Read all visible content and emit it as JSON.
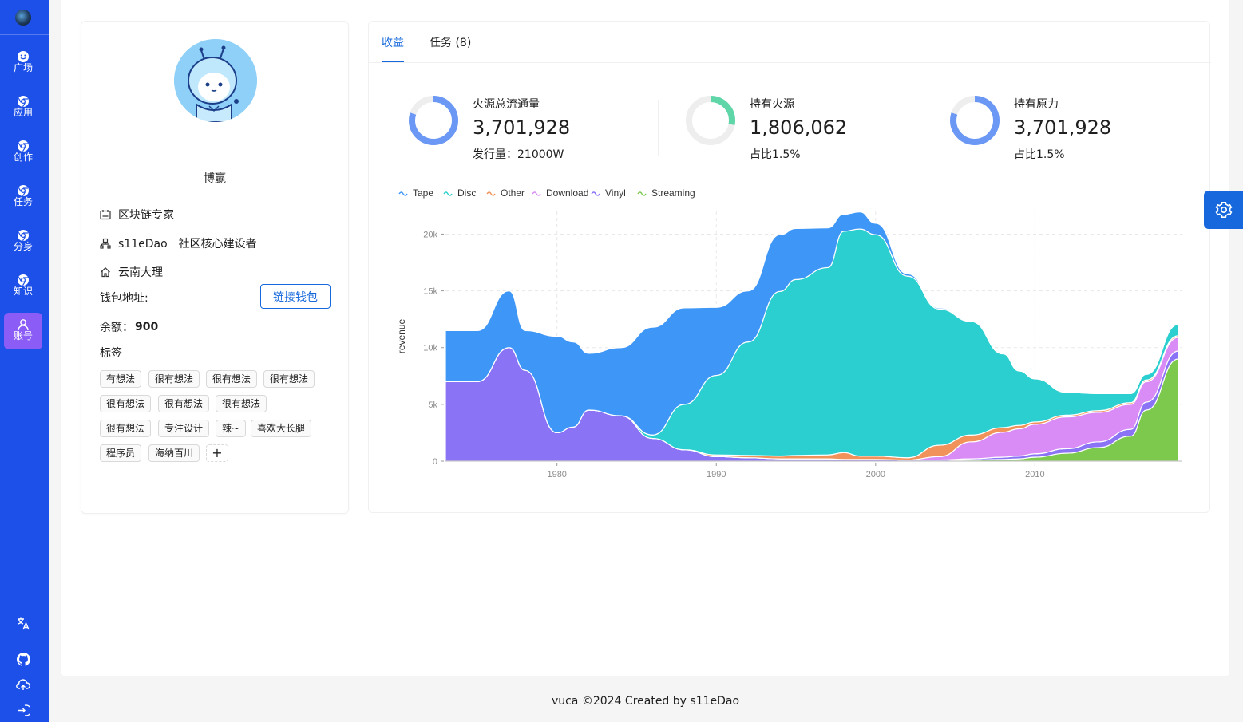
{
  "nav": {
    "items": [
      {
        "label": "广场",
        "icon": "smile-icon"
      },
      {
        "label": "应用",
        "icon": "chrome-icon"
      },
      {
        "label": "创作",
        "icon": "chrome-icon"
      },
      {
        "label": "任务",
        "icon": "chrome-icon"
      },
      {
        "label": "分身",
        "icon": "chrome-icon"
      },
      {
        "label": "知识",
        "icon": "chrome-icon"
      },
      {
        "label": "账号",
        "icon": "user-icon",
        "active": true
      }
    ],
    "bottom_icons": [
      "translate-icon",
      "github-icon",
      "cloud-upload-icon",
      "logout-icon"
    ]
  },
  "profile": {
    "name": "博赢",
    "title": "区块链专家",
    "org": "s11eDao－社区核心建设者",
    "location": "云南大理",
    "wallet_label": "钱包地址:",
    "wallet_button": "链接钱包",
    "balance_label": "余额：",
    "balance_value": "900",
    "tags_label": "标签",
    "tags": [
      "有想法",
      "很有想法",
      "很有想法",
      "很有想法",
      "很有想法",
      "很有想法",
      "很有想法",
      "很有想法",
      "专注设计",
      "辣~",
      "喜欢大长腿",
      "程序员",
      "海纳百川"
    ],
    "add_tag": "+"
  },
  "tabs": [
    {
      "label": "收益",
      "active": true
    },
    {
      "label": "任务 (8)",
      "active": false
    }
  ],
  "stats": [
    {
      "title": "火源总流通量",
      "value": "3,701,928",
      "sub": "发行量：21000W",
      "ring_color": "#6b98f5",
      "ring_fraction": 0.8
    },
    {
      "title": "持有火源",
      "value": "1,806,062",
      "sub": "占比1.5%",
      "ring_color": "#5fd6a8",
      "ring_fraction": 0.28
    },
    {
      "title": "持有原力",
      "value": "3,701,928",
      "sub": "占比1.5%",
      "ring_color": "#6b98f5",
      "ring_fraction": 0.8
    }
  ],
  "chart_data": {
    "type": "area",
    "stacked": true,
    "ylabel": "revenue",
    "xlabel": "",
    "ylim": [
      0,
      22000
    ],
    "xlim": [
      1973,
      2019
    ],
    "y_ticks": [
      {
        "value": 0,
        "label": "0"
      },
      {
        "value": 5000,
        "label": "5k"
      },
      {
        "value": 10000,
        "label": "10k"
      },
      {
        "value": 15000,
        "label": "15k"
      },
      {
        "value": 20000,
        "label": "20k"
      }
    ],
    "x_ticks": [
      {
        "value": 1980,
        "label": "1980"
      },
      {
        "value": 1990,
        "label": "1990"
      },
      {
        "value": 2000,
        "label": "2000"
      },
      {
        "value": 2010,
        "label": "2010"
      }
    ],
    "grid": true,
    "legend_position": "top-left",
    "x": [
      1973,
      1975,
      1977,
      1978,
      1980,
      1981,
      1982,
      1984,
      1986,
      1988,
      1990,
      1992,
      1994,
      1995,
      1997,
      1998,
      1999,
      2000,
      2002,
      2004,
      2006,
      2008,
      2009,
      2010,
      2012,
      2014,
      2016,
      2017,
      2019
    ],
    "series": [
      {
        "name": "Streaming",
        "color": "#7dc94e",
        "values": [
          0,
          0,
          0,
          0,
          0,
          0,
          0,
          0,
          0,
          0,
          0,
          0,
          0,
          0,
          0,
          0,
          0,
          0,
          0,
          0,
          100,
          150,
          200,
          350,
          700,
          1200,
          2200,
          4500,
          9000
        ]
      },
      {
        "name": "Vinyl",
        "color": "#8b73f5",
        "values": [
          7000,
          7000,
          10000,
          8000,
          2500,
          3000,
          4500,
          4000,
          2000,
          1000,
          400,
          300,
          200,
          200,
          200,
          150,
          150,
          150,
          100,
          100,
          100,
          200,
          250,
          300,
          400,
          500,
          600,
          700,
          700
        ]
      },
      {
        "name": "Download",
        "color": "#d98cf5",
        "values": [
          0,
          0,
          0,
          0,
          0,
          0,
          0,
          0,
          0,
          0,
          0,
          0,
          0,
          0,
          0,
          0,
          0,
          0,
          0,
          300,
          1500,
          2200,
          2400,
          2600,
          2800,
          2600,
          2200,
          1800,
          1200
        ]
      },
      {
        "name": "Other",
        "color": "#f0925a",
        "values": [
          0,
          0,
          0,
          0,
          0,
          0,
          0,
          0,
          0,
          0,
          150,
          200,
          250,
          300,
          350,
          600,
          300,
          300,
          200,
          1000,
          600,
          400,
          300,
          200,
          150,
          150,
          150,
          150,
          150
        ]
      },
      {
        "name": "Disc",
        "color": "#2ccfcf",
        "values": [
          0,
          0,
          0,
          0,
          0,
          0,
          0,
          0,
          300,
          4000,
          7000,
          10000,
          14500,
          15500,
          16500,
          19500,
          20000,
          19500,
          16000,
          12000,
          10000,
          6500,
          4800,
          3800,
          2000,
          1500,
          800,
          500,
          1000
        ]
      },
      {
        "name": "Tape",
        "color": "#3e97f7",
        "values": [
          4500,
          4500,
          5000,
          3500,
          8500,
          7500,
          5000,
          6000,
          9500,
          8500,
          6000,
          4500,
          5000,
          4500,
          3500,
          1500,
          1500,
          1000,
          200,
          100,
          50,
          0,
          0,
          0,
          0,
          0,
          0,
          0,
          0
        ]
      }
    ],
    "legend": [
      "Tape",
      "Disc",
      "Other",
      "Download",
      "Vinyl",
      "Streaming"
    ]
  },
  "footer": "vuca ©2024 Created by s11eDao"
}
